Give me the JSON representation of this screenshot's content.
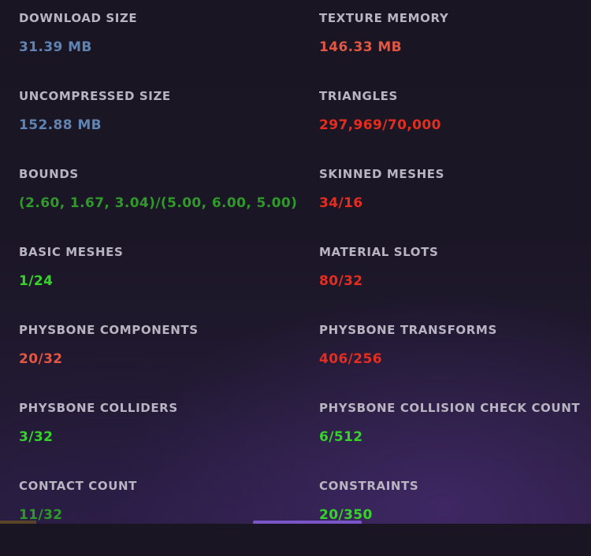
{
  "colors": {
    "info": "#5f84b3",
    "poor": "#e25643",
    "very_poor": "#e52d1f",
    "good": "#2f9a2a",
    "excellent": "#36d32a",
    "label": "#b9b4c2"
  },
  "stats": [
    {
      "label": "DOWNLOAD SIZE",
      "value": "31.39 MB",
      "color": "#5f84b3"
    },
    {
      "label": "TEXTURE MEMORY",
      "value": "146.33 MB",
      "color": "#e25643"
    },
    {
      "label": "UNCOMPRESSED SIZE",
      "value": "152.88 MB",
      "color": "#5f84b3"
    },
    {
      "label": "TRIANGLES",
      "value": "297,969/70,000",
      "color": "#e52d1f"
    },
    {
      "label": "BOUNDS",
      "value": "(2.60, 1.67, 3.04)/(5.00, 6.00, 5.00)",
      "color": "#2f9a2a"
    },
    {
      "label": "SKINNED MESHES",
      "value": "34/16",
      "color": "#e52d1f"
    },
    {
      "label": "BASIC MESHES",
      "value": "1/24",
      "color": "#36d32a"
    },
    {
      "label": "MATERIAL SLOTS",
      "value": "80/32",
      "color": "#e52d1f"
    },
    {
      "label": "PHYSBONE COMPONENTS",
      "value": "20/32",
      "color": "#e25643"
    },
    {
      "label": "PHYSBONE TRANSFORMS",
      "value": "406/256",
      "color": "#e52d1f"
    },
    {
      "label": "PHYSBONE COLLIDERS",
      "value": "3/32",
      "color": "#36d32a"
    },
    {
      "label": "PHYSBONE COLLISION CHECK COUNT",
      "value": "6/512",
      "color": "#36d32a"
    },
    {
      "label": "CONTACT COUNT",
      "value": "11/32",
      "color": "#2f9a2a"
    },
    {
      "label": "CONSTRAINTS",
      "value": "20/350",
      "color": "#36d32a"
    }
  ]
}
